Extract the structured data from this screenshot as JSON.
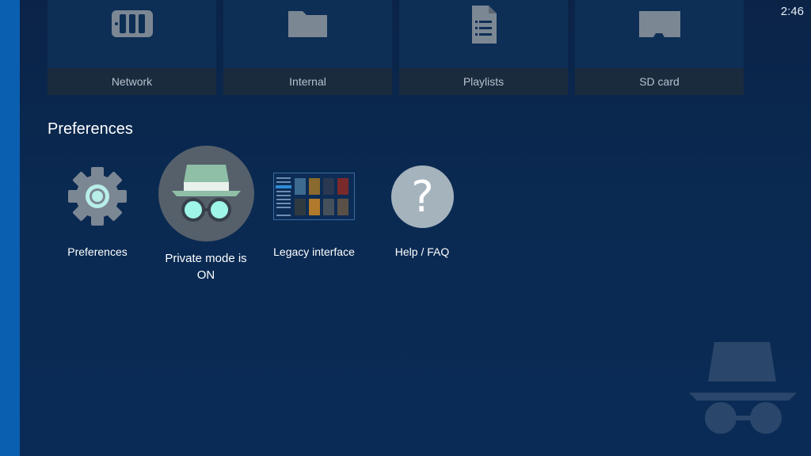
{
  "status": {
    "clock": "2:46"
  },
  "storage_tiles": [
    {
      "label": "Network",
      "icon": "network-storage-icon"
    },
    {
      "label": "Internal",
      "icon": "folder-icon"
    },
    {
      "label": "Playlists",
      "icon": "playlist-document-icon"
    },
    {
      "label": "SD card",
      "icon": "sd-card-icon"
    }
  ],
  "preferences": {
    "section_title": "Preferences",
    "items": [
      {
        "label": "Preferences",
        "icon": "gear-icon"
      },
      {
        "label": "Private mode is ON",
        "icon": "incognito-icon"
      },
      {
        "label": "Legacy interface",
        "icon": "legacy-interface-thumbnail"
      },
      {
        "label": "Help / FAQ",
        "icon": "help-icon"
      }
    ]
  },
  "help_glyph": "?",
  "colors": {
    "accent_bar": "#0b5fb0",
    "background": "#0a2a52",
    "tile": "#0d2e55",
    "tile_label_bg": "#1a2b3e",
    "private_circle": "#56606b",
    "incognito_hat": "#8fbfa7",
    "lens_glow": "#9ef5e8",
    "help_circle": "#a5b3bd"
  },
  "watermark": {
    "icon": "incognito-watermark-icon"
  }
}
